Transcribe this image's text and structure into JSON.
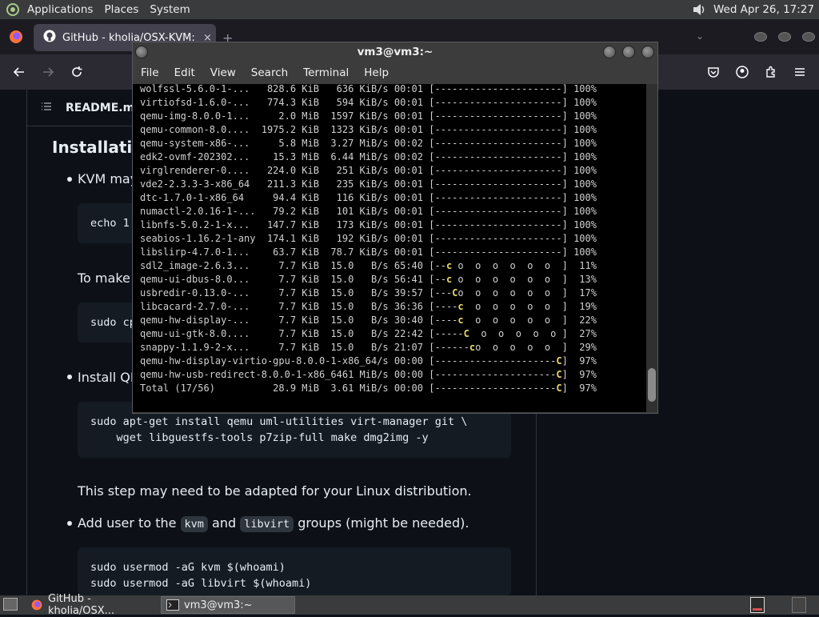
{
  "top_panel": {
    "menus": [
      "Applications",
      "Places",
      "System"
    ],
    "clock": "Wed Apr 26, 17:27"
  },
  "browser": {
    "tab_title": "GitHub - kholia/OSX-KVM: F",
    "tab_close": "×"
  },
  "readme": {
    "file_label": "README.md",
    "heading": "Installation",
    "kvm_text": "KVM may",
    "code_echo": "echo 1",
    "tomake_text": "To make t",
    "code_sudo_cp": "sudo cp",
    "install_text": "Install QE",
    "code_install": "sudo apt-get install qemu uml-utilities virt-manager git \\\n    wget libguestfs-tools p7zip-full make dmg2img -y",
    "adapt_text": "This step may need to be adapted for your Linux distribution.",
    "add_user_prefix": "Add user to the",
    "kvm_code": "kvm",
    "and_text": "and",
    "libvirt_code": "libvirt",
    "groups_suffix": "groups (might be needed).",
    "code_usermod": "sudo usermod -aG kvm $(whoami)\nsudo usermod -aG libvirt $(whoami)"
  },
  "terminal": {
    "title": "vm3@vm3:~",
    "menus": [
      "File",
      "Edit",
      "View",
      "Search",
      "Terminal",
      "Help"
    ],
    "lines": [
      "wolfssl-5.6.0-1-...   828.6 KiB   636 KiB/s 00:01 [----------------------] 100%",
      "virtiofsd-1.6.0-...   774.3 KiB   594 KiB/s 00:01 [----------------------] 100%",
      "qemu-img-8.0.0-1...     2.0 MiB  1597 KiB/s 00:01 [----------------------] 100%",
      "qemu-common-8.0....  1975.2 KiB  1323 KiB/s 00:01 [----------------------] 100%",
      "qemu-system-x86-...     5.8 MiB  3.27 MiB/s 00:02 [----------------------] 100%",
      "edk2-ovmf-202302...    15.3 MiB  6.44 MiB/s 00:02 [----------------------] 100%",
      "virglrenderer-0....   224.0 KiB   251 KiB/s 00:01 [----------------------] 100%",
      "vde2-2.3.3-3-x86_64   211.3 KiB   235 KiB/s 00:01 [----------------------] 100%",
      "dtc-1.7.0-1-x86_64     94.4 KiB   116 KiB/s 00:01 [----------------------] 100%",
      "numactl-2.0.16-1-...   79.2 KiB   101 KiB/s 00:01 [----------------------] 100%",
      "libnfs-5.0.2-1-x...   147.7 KiB   173 KiB/s 00:01 [----------------------] 100%",
      "seabios-1.16.2-1-any  174.1 KiB   192 KiB/s 00:01 [----------------------] 100%",
      "libslirp-4.7.0-1...    63.7 KiB  78.7 KiB/s 00:01 [----------------------] 100%",
      "sdl2_image-2.6.3...     7.7 KiB  15.0   B/s 65:40 [--c o  o  o  o  o  o  ]  11%",
      "qemu-ui-dbus-8.0...     7.7 KiB  15.0   B/s 56:41 [--c o  o  o  o  o  o  ]  13%",
      "usbredir-0.13.0-...     7.7 KiB  15.0   B/s 39:57 [---Co  o  o  o  o  o  ]  17%",
      "libcacard-2.7.0-...     7.7 KiB  15.0   B/s 36:36 [----c  o  o  o  o  o  ]  19%",
      "qemu-hw-display-...     7.7 KiB  15.0   B/s 30:40 [----c  o  o  o  o  o  ]  22%",
      "qemu-ui-gtk-8.0....     7.7 KiB  15.0   B/s 22:42 [-----C  o  o  o  o  o ]  27%",
      "snappy-1.1.9-2-x...     7.7 KiB  15.0   B/s 21:07 [------co  o  o  o  o  ]  29%",
      "qemu-hw-display-virtio-gpu-8.0.0-1-x86_64/s 00:00 [---------------------C]  97%",
      "qemu-hw-usb-redirect-8.0.0-1-x86_6461 MiB/s 00:00 [---------------------C]  97%",
      "Total (17/56)          28.9 MiB  3.61 MiB/s 00:00 [---------------------C]  97%"
    ]
  },
  "taskbar": {
    "tasks": [
      "GitHub - kholia/OSX...",
      "vm3@vm3:~"
    ]
  },
  "colors": {
    "terminal_bg": "#000000",
    "terminal_fg": "#d0d0d0",
    "pacman_yellow": "#e8d96a",
    "github_bg": "#0d1117"
  }
}
